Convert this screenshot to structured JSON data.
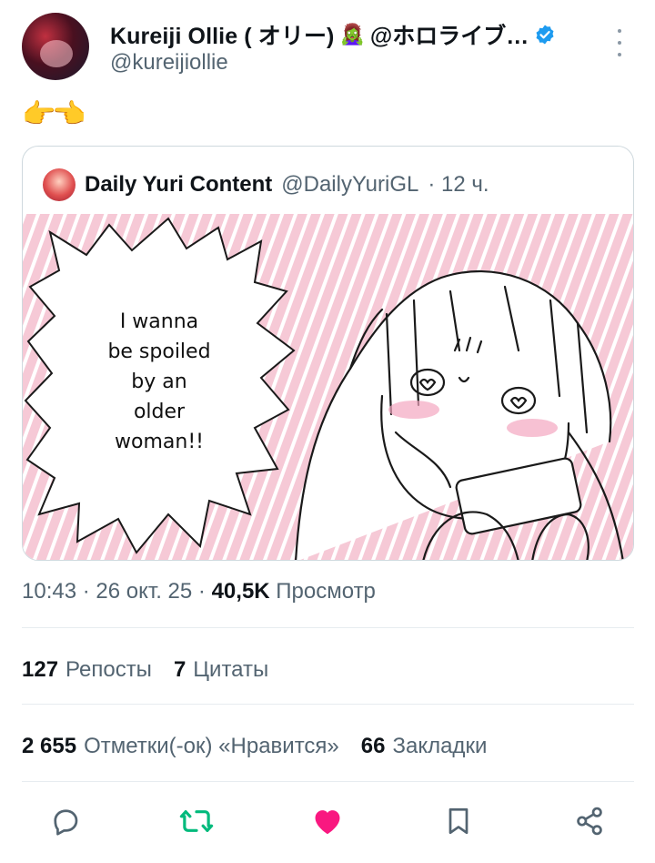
{
  "author": {
    "display_name": "Kureiji Ollie ( オリー)",
    "name_emoji": "🧟‍♀️",
    "name_suffix": "@ホロライブ…",
    "handle": "@kureijiollie",
    "verified": true
  },
  "tweet": {
    "text": "👉👈"
  },
  "quote": {
    "author_name": "Daily Yuri Content",
    "author_handle": "@DailyYuriGL",
    "time": "· 12 ч.",
    "image_speech_text": [
      "I wanna",
      "be spoiled",
      "by an",
      "older",
      "woman!!"
    ]
  },
  "meta": {
    "time": "10:43",
    "date": "· 26 окт. 25 ·",
    "views_count": "40,5K",
    "views_label": "Просмотр"
  },
  "stats": {
    "reposts_count": "127",
    "reposts_label": "Репосты",
    "quotes_count": "7",
    "quotes_label": "Цитаты",
    "likes_count": "2 655",
    "likes_label": "Отметки(-ок) «Нравится»",
    "bookmarks_count": "66",
    "bookmarks_label": "Закладки"
  },
  "actions": {
    "reply_icon": "speech-bubble-icon",
    "repost_icon": "repost-arrows-icon",
    "like_icon": "heart-icon",
    "bookmark_icon": "bookmark-icon",
    "share_icon": "share-nodes-icon",
    "repost_color": "#00ba7c",
    "like_color": "#f91880",
    "neutral_color": "#536471"
  }
}
